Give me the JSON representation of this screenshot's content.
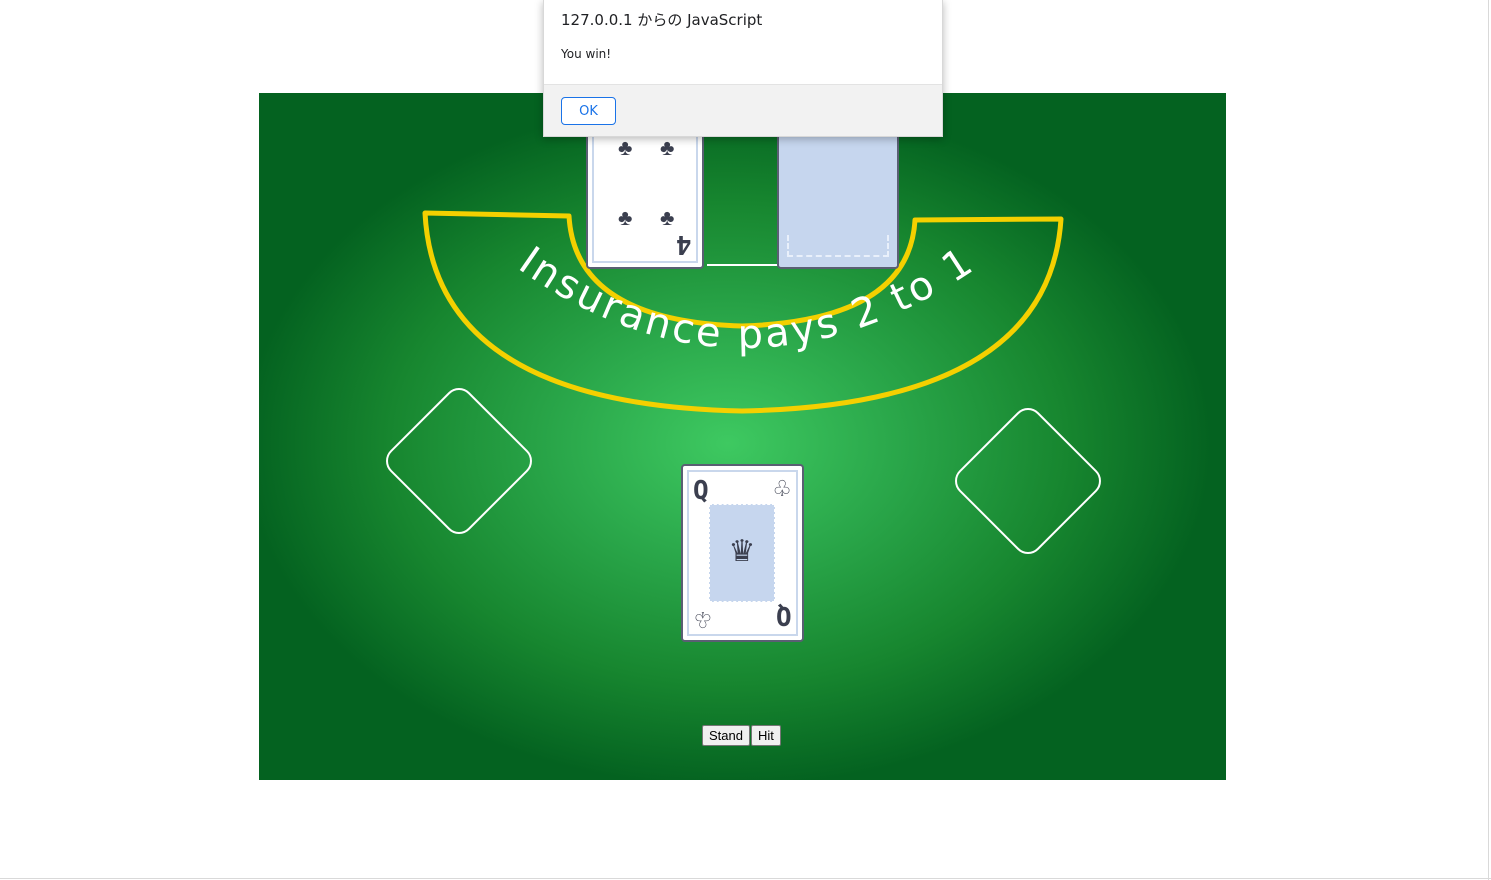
{
  "dialog": {
    "title": "127.0.0.1 からの JavaScript",
    "message": "You win!",
    "ok_label": "OK"
  },
  "table": {
    "insurance_text": "Insurance pays 2 to 1",
    "felt_color": "#1f9a3f",
    "arc_color": "#f4d000"
  },
  "dealer": {
    "cards": [
      {
        "rank": "4",
        "suit": "clubs",
        "suit_glyph": "♣",
        "face_up": true
      },
      {
        "face_up": false
      }
    ]
  },
  "player": {
    "cards": [
      {
        "rank": "Q",
        "suit": "clubs",
        "suit_glyph": "♧",
        "face_up": true,
        "icon": "crown-icon",
        "icon_glyph": "♛"
      }
    ]
  },
  "controls": {
    "stand_label": "Stand",
    "hit_label": "Hit"
  }
}
